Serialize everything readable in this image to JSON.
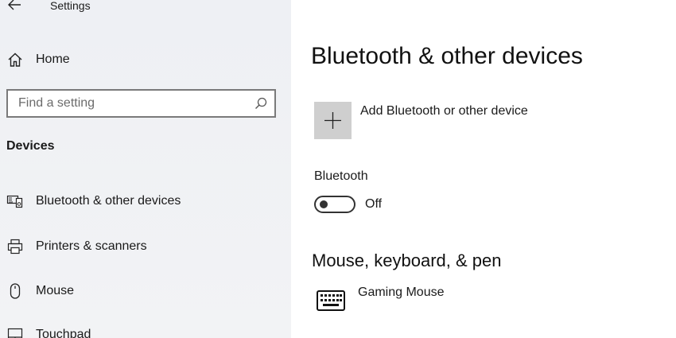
{
  "window": {
    "title": "Settings"
  },
  "sidebar": {
    "home_label": "Home",
    "search_placeholder": "Find a setting",
    "section_label": "Devices",
    "items": [
      {
        "label": "Bluetooth & other devices",
        "icon": "bluetooth-devices-icon"
      },
      {
        "label": "Printers & scanners",
        "icon": "printer-icon"
      },
      {
        "label": "Mouse",
        "icon": "mouse-icon"
      },
      {
        "label": "Touchpad",
        "icon": "touchpad-icon"
      }
    ]
  },
  "main": {
    "title": "Bluetooth & other devices",
    "add_device_label": "Add Bluetooth or other device",
    "bluetooth": {
      "label": "Bluetooth",
      "state": "Off",
      "enabled": false
    },
    "mouse_keyboard_pen": {
      "heading": "Mouse, keyboard, & pen",
      "devices": [
        {
          "name": "Gaming Mouse",
          "icon": "keyboard-icon"
        }
      ]
    }
  },
  "colors": {
    "sidebar_bg": "#f0f1f4",
    "add_button_bg": "#cfcfcf",
    "toggle_off": "#333333"
  }
}
